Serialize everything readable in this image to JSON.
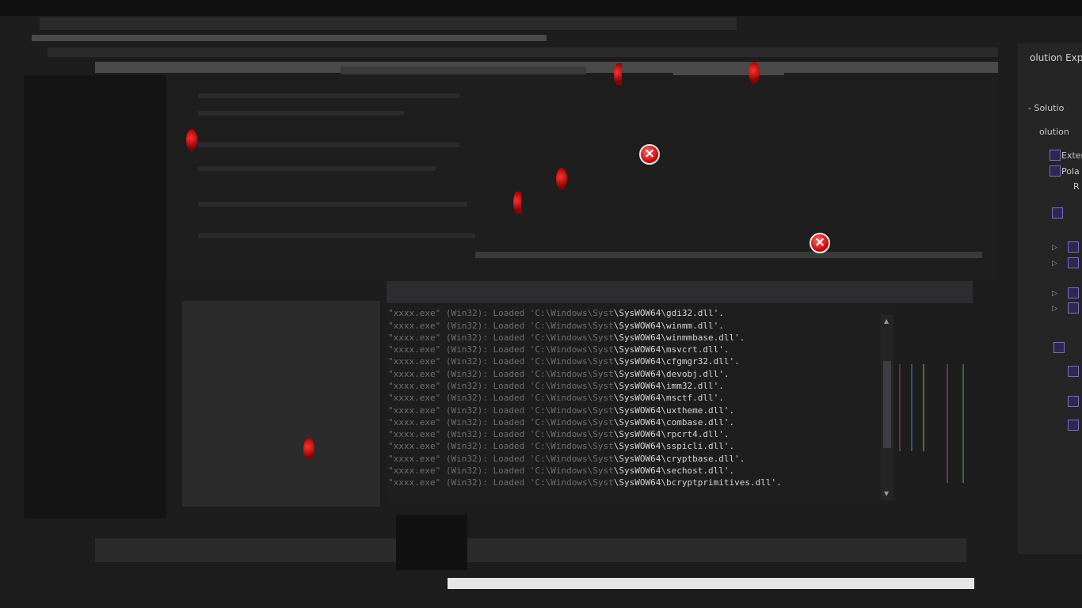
{
  "solution_explorer": {
    "title": "olution Expl",
    "tab_label": "- Solutio",
    "search_text": "olution",
    "items": [
      "Exter",
      "Pola",
      "R"
    ]
  },
  "output": {
    "prefix_dim": "\"xxxx.exe\" (Win32): Loaded 'C:\\Windows\\Syst",
    "lines": [
      "\\SysWOW64\\gdi32.dll'.",
      "\\SysWOW64\\winmm.dll'.",
      "\\SysWOW64\\winmmbase.dll'.",
      "\\SysWOW64\\msvcrt.dll'.",
      "\\SysWOW64\\cfgmgr32.dll'.",
      "\\SysWOW64\\devobj.dll'.",
      "\\SysWOW64\\imm32.dll'.",
      "\\SysWOW64\\msctf.dll'.",
      "\\SysWOW64\\uxtheme.dll'.",
      "\\SysWOW64\\combase.dll'.",
      "\\SysWOW64\\rpcrt4.dll'.",
      "\\SysWOW64\\sspicli.dll'.",
      "\\SysWOW64\\cryptbase.dll'.",
      "\\SysWOW64\\sechost.dll'.",
      "\\SysWOW64\\bcryptprimitives.dll'."
    ]
  },
  "icons": {
    "breakpoint": "breakpoint-icon",
    "error": "error-icon",
    "expand": "expand-triangle-icon"
  },
  "colors": {
    "breakpoint": "#d40000",
    "error": "#e02020",
    "background": "#1e1e1e"
  }
}
